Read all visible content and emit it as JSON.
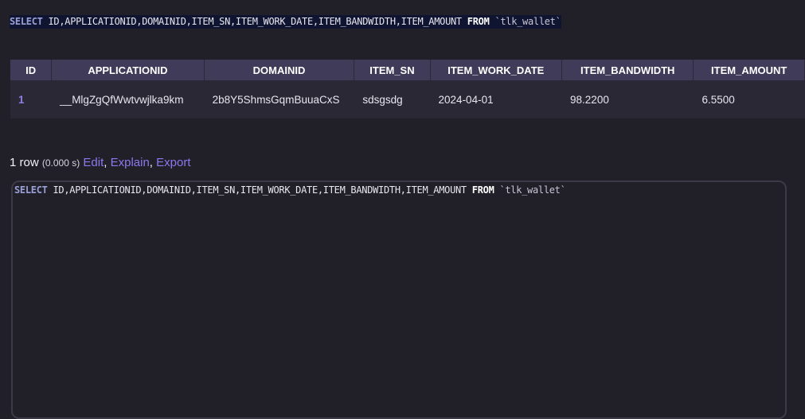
{
  "query": {
    "select_kw": "SELECT",
    "columns": "ID,APPLICATIONID,DOMAINID,ITEM_SN,ITEM_WORK_DATE,ITEM_BANDWIDTH,ITEM_AMOUNT",
    "from_kw": "FROM",
    "table": "`tlk_wallet`"
  },
  "results": {
    "headers": [
      "ID",
      "APPLICATIONID",
      "DOMAINID",
      "ITEM_SN",
      "ITEM_WORK_DATE",
      "ITEM_BANDWIDTH",
      "ITEM_AMOUNT"
    ],
    "rows": [
      [
        "1",
        "__MlgZgQfWwtvwjlka9km",
        "2b8Y5ShmsGqmBuuaCxS",
        "sdsgsdg",
        "2024-04-01",
        "98.2200",
        "6.5500"
      ]
    ]
  },
  "status": {
    "rows_text": "1 row",
    "time_text": "(0.000 s)",
    "edit": "Edit",
    "explain": "Explain",
    "export": "Export",
    "sep": ","
  }
}
